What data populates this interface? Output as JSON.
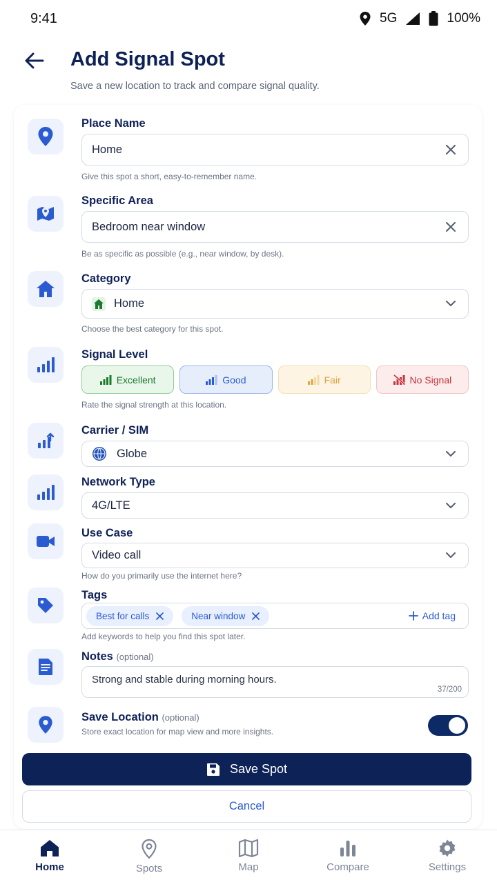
{
  "status": {
    "time": "9:41",
    "network": "5G",
    "battery": "100%"
  },
  "header": {
    "title": "Add Signal Spot",
    "subtitle": "Save a new location to track and compare signal quality."
  },
  "form": {
    "place_name": {
      "label": "Place Name",
      "value": "Home",
      "help": "Give this spot a short, easy-to-remember name."
    },
    "specific_area": {
      "label": "Specific Area",
      "value": "Bedroom near window",
      "help": "Be as specific as possible (e.g., near window, by desk)."
    },
    "category": {
      "label": "Category",
      "value": "Home",
      "help": "Choose the best category for this spot."
    },
    "signal_level": {
      "label": "Signal Level",
      "options": [
        "Excellent",
        "Good",
        "Fair",
        "No Signal"
      ],
      "help": "Rate the signal strength at this location."
    },
    "carrier": {
      "label": "Carrier / SIM",
      "value": "Globe"
    },
    "network_type": {
      "label": "Network Type",
      "value": "4G/LTE"
    },
    "use_case": {
      "label": "Use Case",
      "value": "Video call",
      "help": "How do you primarily use the internet here?"
    },
    "tags": {
      "label": "Tags",
      "items": [
        "Best for calls",
        "Near window"
      ],
      "add_label": "Add tag",
      "help": "Add keywords to help you find this spot later."
    },
    "notes": {
      "label": "Notes",
      "optional": "(optional)",
      "value": "Strong and stable during morning hours.",
      "counter": "37/200"
    },
    "save_location": {
      "label": "Save Location",
      "optional": "(optional)",
      "help": "Store exact location for map view and more insights.",
      "enabled": true
    }
  },
  "actions": {
    "save": "Save Spot",
    "cancel": "Cancel"
  },
  "nav": [
    {
      "label": "Home",
      "icon": "home-icon",
      "active": true
    },
    {
      "label": "Spots",
      "icon": "location-pin-icon"
    },
    {
      "label": "Map",
      "icon": "map-icon"
    },
    {
      "label": "Compare",
      "icon": "bar-chart-icon"
    },
    {
      "label": "Settings",
      "icon": "gear-icon"
    }
  ],
  "colors": {
    "primary": "#0d2257",
    "accent": "#2a5bd0",
    "excellent": "#1c7a2d",
    "fair": "#e2a43f",
    "no_signal": "#c7323a"
  }
}
